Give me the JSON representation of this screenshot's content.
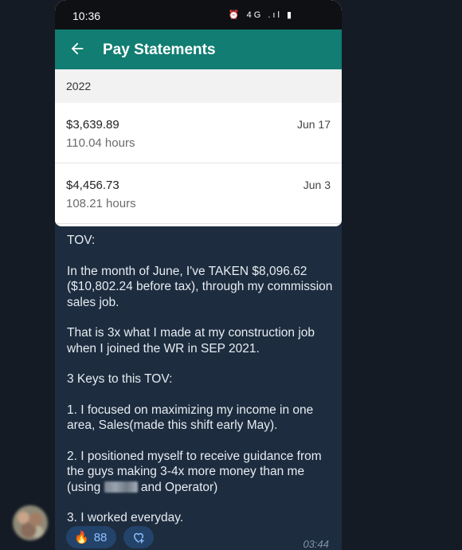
{
  "phone": {
    "status_time": "10:36",
    "status_icons": "⏰ 4G .ıl ▮",
    "appbar_title": "Pay Statements",
    "year": "2022",
    "statements": [
      {
        "amount": "$3,639.89",
        "hours": "110.04 hours",
        "date": "Jun 17"
      },
      {
        "amount": "$4,456.73",
        "hours": "108.21 hours",
        "date": "Jun 3"
      }
    ]
  },
  "message": {
    "heading": "TOV:",
    "para1": "In the month of June, I've TAKEN $8,096.62 ($10,802.24 before tax), through my commission sales job.",
    "para2": "That is 3x what I made at my construction job when I joined the WR in SEP 2021.",
    "para3": "3 Keys to this TOV:",
    "para4": "1. I focused on maximizing my income in one area, Sales(made this shift early May).",
    "para5_a": "2. I positioned myself to receive guidance from the guys making 3-4x more money than me (using",
    "para5_b": "and Operator)",
    "para6": "3. I worked everyday.",
    "reaction_emoji": "🔥",
    "reaction_count": "88",
    "time": "03:44"
  },
  "colors": {
    "background": "#151b25",
    "bubble": "#1d2c3e",
    "appbar": "#127d72",
    "reaction_bg": "#24436a"
  }
}
